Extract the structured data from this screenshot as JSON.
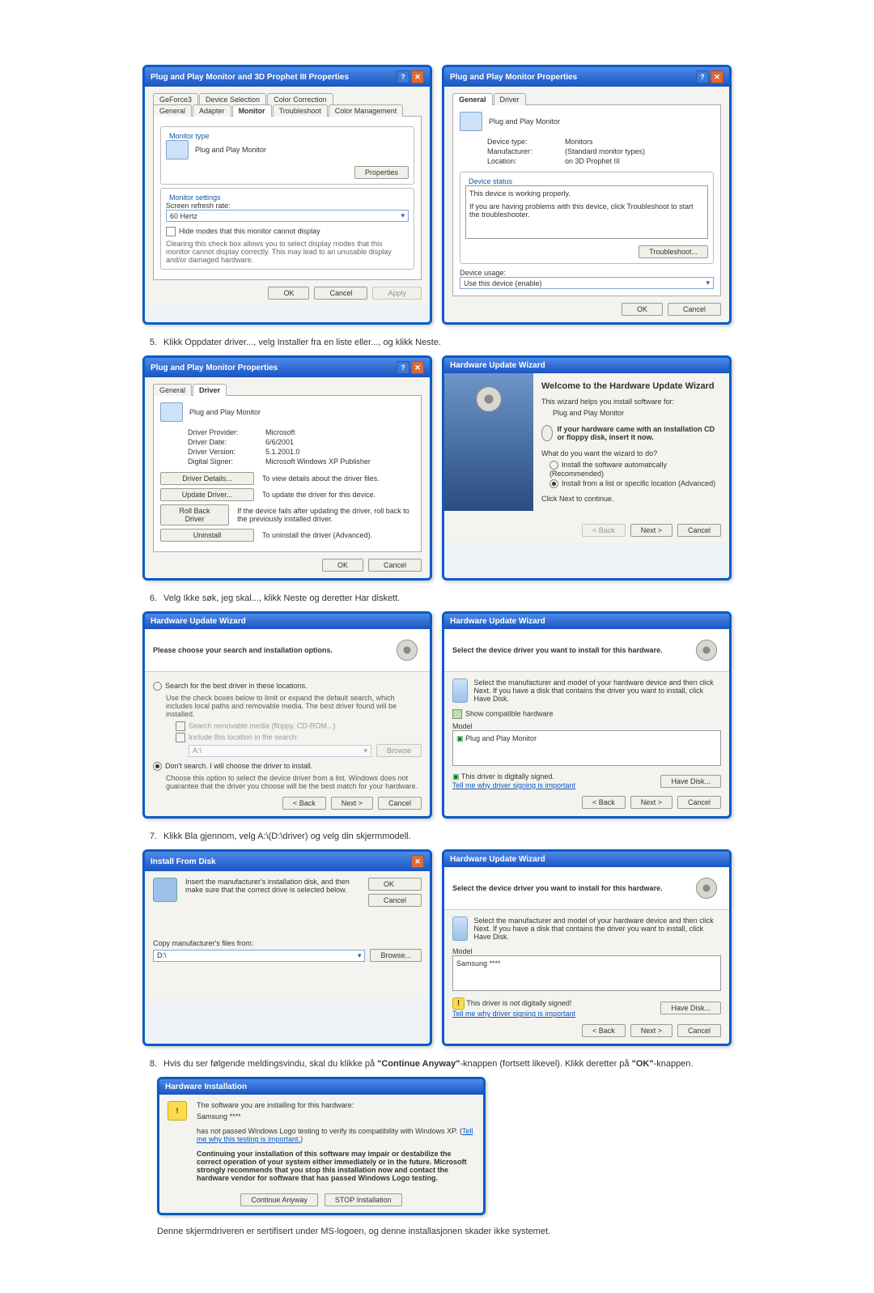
{
  "dialogs": {
    "d1": {
      "title": "Plug and Play Monitor and 3D Prophet III Properties",
      "tabs_top": [
        "GeForce3",
        "Device Selection",
        "Color Correction"
      ],
      "tabs_bottom": [
        "General",
        "Adapter",
        "Monitor",
        "Troubleshoot",
        "Color Management"
      ],
      "monitor_type_title": "Monitor type",
      "monitor_name": "Plug and Play Monitor",
      "properties_btn": "Properties",
      "monitor_settings_title": "Monitor settings",
      "refresh_label": "Screen refresh rate:",
      "refresh_value": "60 Hertz",
      "hide_modes_label": "Hide modes that this monitor cannot display",
      "hide_modes_note": "Clearing this check box allows you to select display modes that this monitor cannot display correctly. This may lead to an unusable display and/or damaged hardware.",
      "ok": "OK",
      "cancel": "Cancel",
      "apply": "Apply"
    },
    "d2": {
      "title": "Plug and Play Monitor Properties",
      "tabs": [
        "General",
        "Driver"
      ],
      "monitor_name": "Plug and Play Monitor",
      "kv": [
        [
          "Device type:",
          "Monitors"
        ],
        [
          "Manufacturer:",
          "(Standard monitor types)"
        ],
        [
          "Location:",
          "on 3D Prophet III"
        ]
      ],
      "status_title": "Device status",
      "status_text": "This device is working properly.",
      "status_note": "If you are having problems with this device, click Troubleshoot to start the troubleshooter.",
      "troubleshoot_btn": "Troubleshoot...",
      "usage_label": "Device usage:",
      "usage_value": "Use this device (enable)",
      "ok": "OK",
      "cancel": "Cancel"
    },
    "d3": {
      "title": "Plug and Play Monitor Properties",
      "tabs": [
        "General",
        "Driver"
      ],
      "monitor_name": "Plug and Play Monitor",
      "kv": [
        [
          "Driver Provider:",
          "Microsoft"
        ],
        [
          "Driver Date:",
          "6/6/2001"
        ],
        [
          "Driver Version:",
          "5.1.2001.0"
        ],
        [
          "Digital Signer:",
          "Microsoft Windows XP Publisher"
        ]
      ],
      "btns": [
        "Driver Details...",
        "Update Driver...",
        "Roll Back Driver",
        "Uninstall"
      ],
      "descs": [
        "To view details about the driver files.",
        "To update the driver for this device.",
        "If the device fails after updating the driver, roll back to the previously installed driver.",
        "To uninstall the driver (Advanced)."
      ],
      "ok": "OK",
      "cancel": "Cancel"
    },
    "d4": {
      "title": "Hardware Update Wizard",
      "heading": "Welcome to the Hardware Update Wizard",
      "intro": "This wizard helps you install software for:",
      "device": "Plug and Play Monitor",
      "cd_text": "If your hardware came with an installation CD or floppy disk, insert it now.",
      "question": "What do you want the wizard to do?",
      "opt1": "Install the software automatically (Recommended)",
      "opt2": "Install from a list or specific location (Advanced)",
      "continue": "Click Next to continue.",
      "back": "< Back",
      "next": "Next >",
      "cancel": "Cancel"
    },
    "d5": {
      "title": "Hardware Update Wizard",
      "header": "Please choose your search and installation options.",
      "opt1": "Search for the best driver in these locations.",
      "opt1_note": "Use the check boxes below to limit or expand the default search, which includes local paths and removable media. The best driver found will be installed.",
      "chk1": "Search removable media (floppy, CD-ROM...)",
      "chk2": "Include this location in the search:",
      "path": "A:\\",
      "browse": "Browse",
      "opt2": "Don't search. I will choose the driver to install.",
      "opt2_note": "Choose this option to select the device driver from a list. Windows does not guarantee that the driver you choose will be the best match for your hardware.",
      "back": "< Back",
      "next": "Next >",
      "cancel": "Cancel"
    },
    "d6": {
      "title": "Hardware Update Wizard",
      "header": "Select the device driver you want to install for this hardware.",
      "note": "Select the manufacturer and model of your hardware device and then click Next. If you have a disk that contains the driver you want to install, click Have Disk.",
      "chk": "Show compatible hardware",
      "model_label": "Model",
      "model": "Plug and Play Monitor",
      "signed": "This driver is digitally signed.",
      "why_link": "Tell me why driver signing is important",
      "have_disk": "Have Disk...",
      "back": "< Back",
      "next": "Next >",
      "cancel": "Cancel"
    },
    "d7": {
      "title": "Install From Disk",
      "msg": "Insert the manufacturer's installation disk, and then make sure that the correct drive is selected below.",
      "ok": "OK",
      "cancel": "Cancel",
      "copy_label": "Copy manufacturer's files from:",
      "path": "D:\\",
      "browse": "Browse..."
    },
    "d8": {
      "title": "Hardware Update Wizard",
      "header": "Select the device driver you want to install for this hardware.",
      "note": "Select the manufacturer and model of your hardware device and then click Next. If you have a disk that contains the driver you want to install, click Have Disk.",
      "model_label": "Model",
      "model": "Samsung ****",
      "unsigned": "This driver is not digitally signed!",
      "why_link": "Tell me why driver signing is important",
      "have_disk": "Have Disk...",
      "back": "< Back",
      "next": "Next >",
      "cancel": "Cancel"
    },
    "d9": {
      "title": "Hardware Installation",
      "line1": "The software you are installing for this hardware:",
      "device": "Samsung ****",
      "line2_a": "has not passed Windows Logo testing to verify its compatibility with Windows XP. (",
      "line2_link": "Tell me why this testing is important.",
      "line2_b": ")",
      "bold": "Continuing your installation of this software may impair or destabilize the correct operation of your system either immediately or in the future. Microsoft strongly recommends that you stop this installation now and contact the hardware vendor for software that has passed Windows Logo testing.",
      "cont": "Continue Anyway",
      "stop": "STOP Installation"
    }
  },
  "steps": {
    "s5": "Klikk Oppdater driver..., velg Installer fra en liste eller..., og klikk Neste.",
    "s6": "Velg Ikke søk, jeg skal..., klikk Neste og deretter Har diskett.",
    "s7": "Klikk Bla gjennom, velg A:\\(D:\\driver) og velg din skjermmodell.",
    "s8a": "Hvis du ser følgende meldingsvindu, skal du klikke på ",
    "s8b": "\"Continue Anyway\"",
    "s8c": "-knappen (fortsett likevel). Klikk deretter på ",
    "s8d": "\"OK\"",
    "s8e": "-knappen.",
    "footer": "Denne skjermdriveren er sertifisert under MS-logoen, og denne installasjonen skader ikke systemet."
  }
}
